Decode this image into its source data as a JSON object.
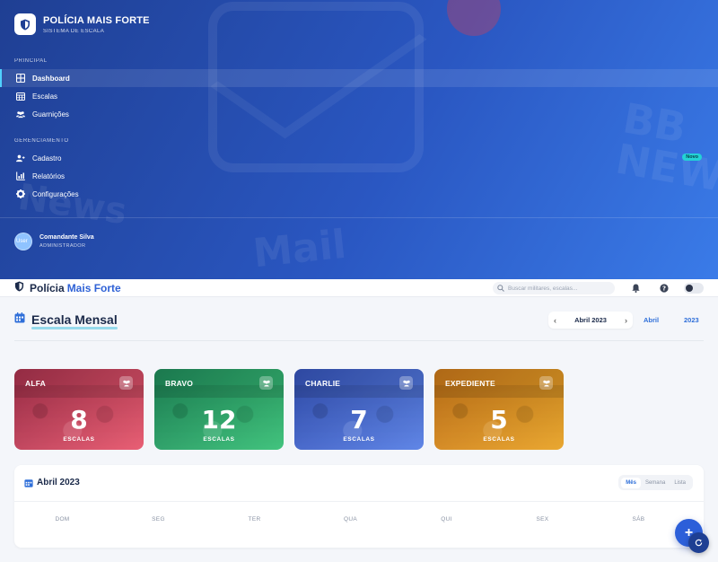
{
  "brand": {
    "title": "POLÍCIA MAIS FORTE",
    "subtitle": "SISTEMA DE ESCALA"
  },
  "sidebar": {
    "sections": [
      {
        "label": "PRINCIPAL"
      },
      {
        "label": "GERENCIAMENTO"
      }
    ],
    "items": [
      {
        "label": "Dashboard",
        "icon": "grid-icon"
      },
      {
        "label": "Escalas",
        "icon": "calendar-icon"
      },
      {
        "label": "Guarnições",
        "icon": "users-icon"
      },
      {
        "label": "Cadastro",
        "icon": "user-plus-icon",
        "badge": "Novo"
      },
      {
        "label": "Relatórios",
        "icon": "chart-icon"
      },
      {
        "label": "Configurações",
        "icon": "gear-icon"
      }
    ],
    "user": {
      "name": "Comandante Silva",
      "role": "ADMINISTRADOR",
      "avatar_alt": "User"
    },
    "background_text": {
      "mail": "Mail",
      "news": "News",
      "bbc": "BB\nNEW"
    }
  },
  "topbar": {
    "brand_part1": "Polícia",
    "brand_part2": "Mais Forte",
    "search_placeholder": "Buscar militares, escalas..."
  },
  "page": {
    "title": "Escala Mensal",
    "month_label": "Abril 2023",
    "month_select": "Abril",
    "year_select": "2023"
  },
  "squads": [
    {
      "name": "ALFA",
      "count": "8",
      "unit": "ESCALAS",
      "color_start": "#a8324d",
      "color_end": "#e85a70"
    },
    {
      "name": "BRAVO",
      "count": "12",
      "unit": "ESCALAS",
      "color_start": "#1f8a5a",
      "color_end": "#3cc27a"
    },
    {
      "name": "CHARLIE",
      "count": "7",
      "unit": "ESCALAS",
      "color_start": "#3553b8",
      "color_end": "#5b82e6"
    },
    {
      "name": "EXPEDIENTE",
      "count": "5",
      "unit": "ESCALAS",
      "color_start": "#c8771a",
      "color_end": "#e9a52a"
    }
  ],
  "calendar": {
    "title": "Abril 2023",
    "views": [
      "Mês",
      "Semana",
      "Lista"
    ],
    "active_view": "Mês",
    "weekdays": [
      "DOM",
      "SEG",
      "TER",
      "QUA",
      "QUI",
      "SEX",
      "SÁB"
    ]
  },
  "fab": {
    "label": "+"
  },
  "colors": {
    "accent": "#2f6fd9",
    "sidebar_start": "#1f3f93",
    "sidebar_end": "#3a7be8",
    "badge": "#23d2d5"
  }
}
